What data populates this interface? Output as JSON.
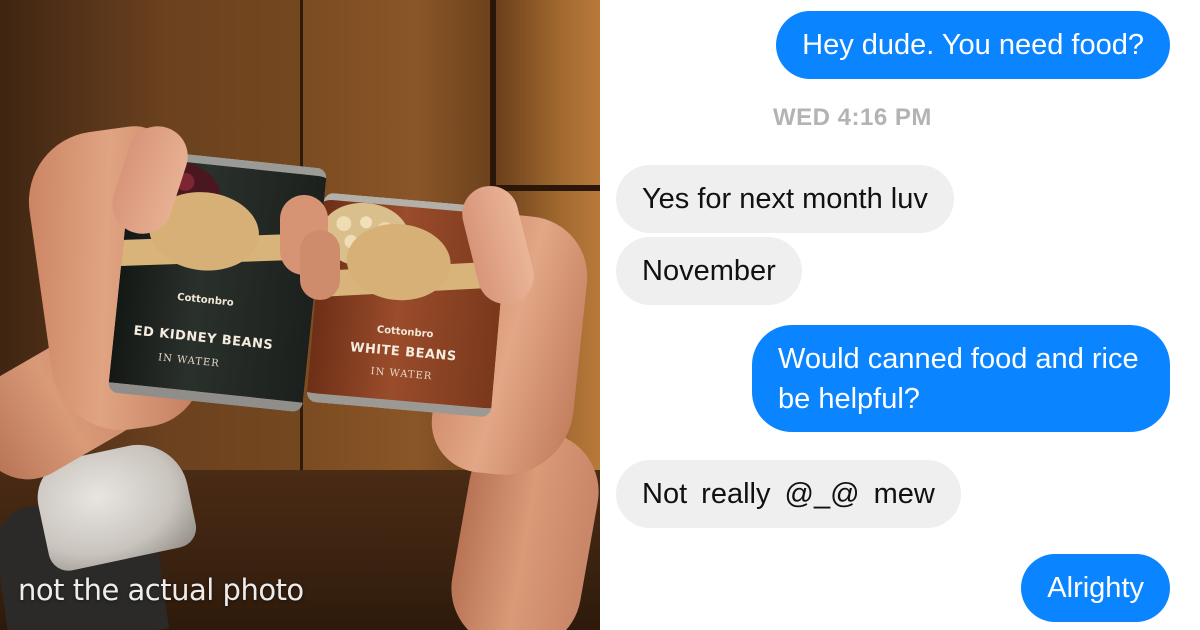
{
  "photo": {
    "caption": "not the actual photo",
    "can_red": {
      "brand": "Cottonbro",
      "product": "ED KIDNEY BEANS",
      "subtext": "IN WATER"
    },
    "can_white": {
      "brand": "Cottonbro",
      "product": "WHITE BEANS",
      "subtext": "IN WATER"
    }
  },
  "chat": {
    "colors": {
      "outgoing_bubble": "#0b84ff",
      "incoming_bubble": "#efefef",
      "timestamp": "#b3b3b3"
    },
    "timestamp": "WED 4:16 PM",
    "messages": [
      {
        "direction": "outgoing",
        "text": "Hey dude. You need food?"
      },
      {
        "direction": "incoming",
        "text": "Yes for next month luv"
      },
      {
        "direction": "incoming",
        "text": "November"
      },
      {
        "direction": "outgoing",
        "text": "Would canned food and rice be helpful?"
      },
      {
        "direction": "incoming",
        "text": "Not really  @_@  mew"
      },
      {
        "direction": "outgoing",
        "text": "Alrighty"
      }
    ]
  }
}
